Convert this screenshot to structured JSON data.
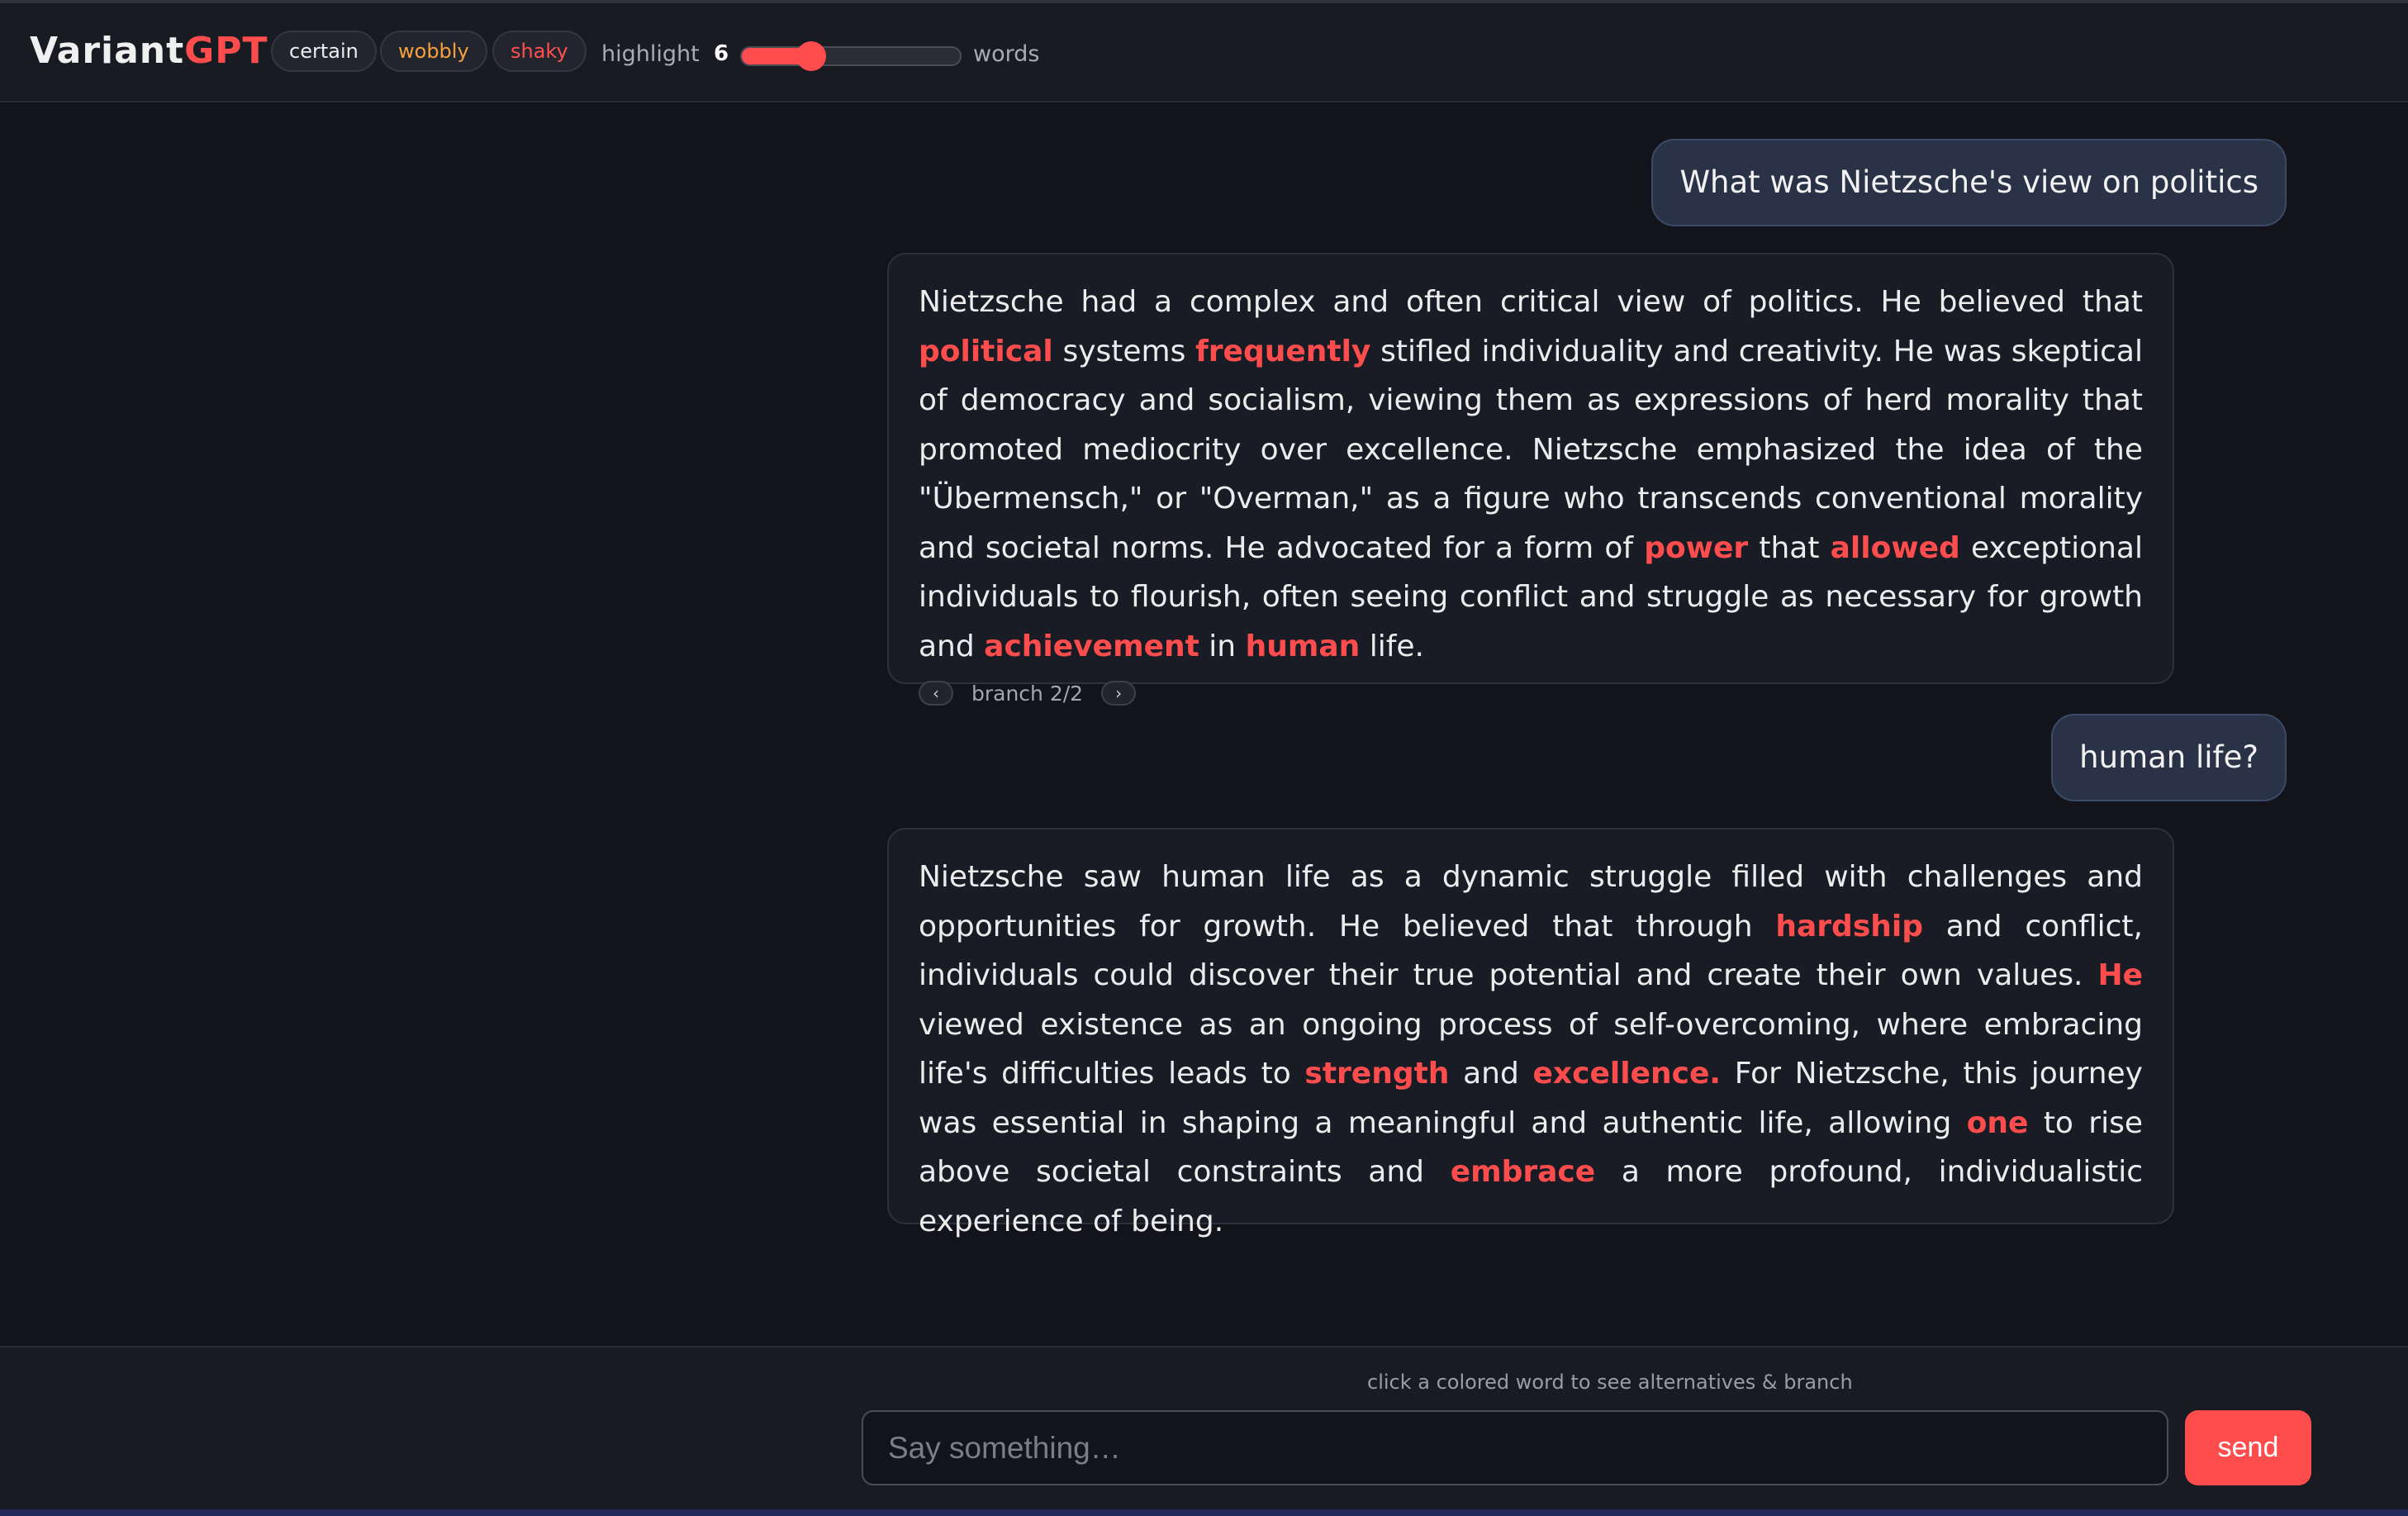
{
  "header": {
    "logo_part1": "Variant",
    "logo_part2": "GPT",
    "chips": {
      "certain": "certain",
      "wobbly": "wobbly",
      "shaky": "shaky"
    },
    "highlight_label": "highlight",
    "highlight_value": "6",
    "highlight_fraction": 0.32,
    "words_label": "words"
  },
  "conversation": {
    "user1": "What was Nietzsche's view on politics",
    "bot1": {
      "segments": [
        {
          "t": "Nietzsche had a complex and often critical view of politics. He believed that "
        },
        {
          "t": "political",
          "hot": true
        },
        {
          "t": " systems "
        },
        {
          "t": "frequently",
          "hot": true
        },
        {
          "t": " stifled individuality and creativity. He was skeptical of democracy and socialism, viewing them as expressions of herd morality that promoted mediocrity over excellence. Nietzsche emphasized the idea of the \"Übermensch,\" or \"Overman,\" as a figure who transcends conventional morality and societal norms. He advocated for a form of "
        },
        {
          "t": "power",
          "hot": true
        },
        {
          "t": " that "
        },
        {
          "t": "allowed",
          "hot": true
        },
        {
          "t": " exceptional individuals to flourish, often seeing conflict and struggle as necessary for growth and "
        },
        {
          "t": "achievement",
          "hot": true
        },
        {
          "t": " in "
        },
        {
          "t": "human",
          "hot": true
        },
        {
          "t": " life."
        }
      ],
      "branch_label": "branch 2/2",
      "prev_icon": "‹",
      "next_icon": "›"
    },
    "user2": "human life?",
    "bot2": {
      "segments": [
        {
          "t": "Nietzsche saw human life as a dynamic struggle filled with challenges and opportunities for growth. He believed that through "
        },
        {
          "t": "hardship",
          "hot": true
        },
        {
          "t": " and conflict, individuals could discover their true potential and create their own values. "
        },
        {
          "t": "He",
          "hot": true
        },
        {
          "t": " viewed existence as an ongoing process of self-overcoming, where embracing life's difficulties leads to "
        },
        {
          "t": "strength",
          "hot": true
        },
        {
          "t": " and "
        },
        {
          "t": "excellence.",
          "hot": true
        },
        {
          "t": " For Nietzsche, this journey was essential in shaping a meaningful and authentic life, allowing "
        },
        {
          "t": "one",
          "hot": true
        },
        {
          "t": " to rise above societal constraints and "
        },
        {
          "t": "embrace",
          "hot": true
        },
        {
          "t": " a more profound, individualistic experience of being."
        }
      ]
    }
  },
  "footer": {
    "hint": "click a colored word to see alternatives & branch",
    "input_placeholder": "Say something…",
    "send_label": "send"
  },
  "colors": {
    "accent": "#ff4d4d",
    "wobbly": "#f5a23d",
    "background": "#13141b"
  }
}
